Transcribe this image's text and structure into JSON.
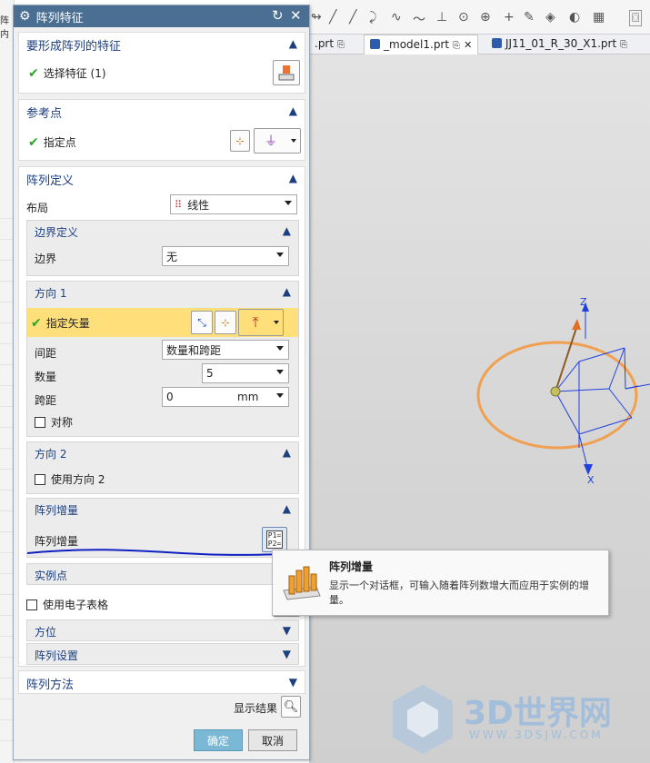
{
  "dialog": {
    "title": "阵列特征",
    "feature_section": {
      "title": "要形成阵列的特征",
      "item": "选择特征 (1)"
    },
    "reference_section": {
      "title": "参考点",
      "item": "指定点"
    },
    "array_def": {
      "title": "阵列定义",
      "layout_label": "布局",
      "layout_value": "线性",
      "boundary": {
        "title": "边界定义",
        "label": "边界",
        "value": "无"
      },
      "direction1": {
        "title": "方向 1",
        "vector_label": "指定矢量",
        "spacing_label": "间距",
        "spacing_value": "数量和跨距",
        "count_label": "数量",
        "count_value": "5",
        "span_label": "跨距",
        "span_value": "0",
        "span_unit": "mm",
        "symmetric_label": "对称"
      },
      "direction2": {
        "title": "方向 2",
        "use_label": "使用方向 2"
      },
      "increment": {
        "title": "阵列增量",
        "label": "阵列增量",
        "icon_text": "P1=\nP2="
      },
      "instance_points": {
        "title": "实例点"
      },
      "spreadsheet_label": "使用电子表格",
      "orientation": {
        "title": "方位"
      },
      "settings": {
        "title": "阵列设置"
      }
    },
    "method": {
      "title": "阵列方法"
    },
    "show_result_label": "显示结果",
    "ok_label": "确定",
    "cancel_label": "取消"
  },
  "tabs": [
    {
      "label": ".prt"
    },
    {
      "label": "_model1.prt"
    },
    {
      "label": "JJ11_01_R_30_X1.prt"
    }
  ],
  "left_stub": "阵内",
  "tooltip": {
    "title": "阵列增量",
    "body": "显示一个对话框，可输入随着阵列数增大而应用于实例的增量。"
  },
  "axes": {
    "z": "Z",
    "x": "X"
  },
  "watermark": {
    "text": "3D世界网",
    "url": "WWW.3DSJW.COM"
  },
  "colors": {
    "title_bar": "#4a6f93",
    "section_title": "#1c3f80",
    "highlight": "#ffdf7a",
    "ok_button": "#7ab8d6",
    "circle": "#f0a050",
    "wire": "#2040e0"
  }
}
